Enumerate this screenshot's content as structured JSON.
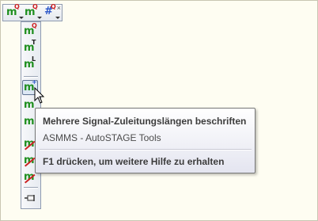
{
  "tooltip": {
    "title": "Mehrere Signal-Zuleitungslängen beschriften",
    "subtitle": "ASMMS - AutoSTAGE Tools",
    "help": "F1 drücken, um weitere Hilfe zu erhalten"
  },
  "htoolbar": {
    "buttons": [
      {
        "glyph": "m",
        "badge": "Q"
      },
      {
        "glyph": "m",
        "badge": "Q"
      },
      {
        "glyph": "#",
        "badge": "Q"
      }
    ],
    "close": "×"
  },
  "vtoolbar": {
    "buttons": [
      {
        "glyph": "m",
        "badge": "Q"
      },
      {
        "glyph": "m",
        "badge": "T"
      },
      {
        "glyph": "m",
        "badge": "L"
      },
      {
        "glyph": "m",
        "badge": "+"
      },
      {
        "glyph": "m",
        "badge": ""
      },
      {
        "glyph": "m",
        "badge": ""
      },
      {
        "glyph": "m",
        "badge": ""
      },
      {
        "glyph": "m",
        "badge": ""
      },
      {
        "glyph": "m",
        "badge": ""
      }
    ]
  }
}
